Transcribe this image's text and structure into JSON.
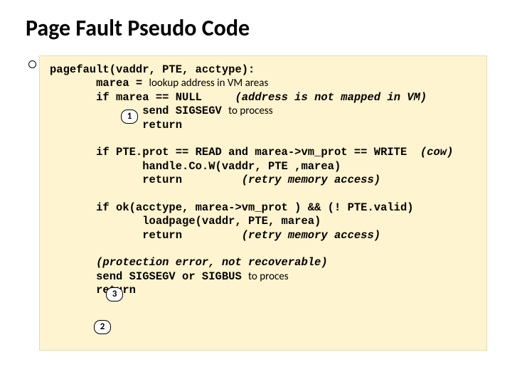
{
  "title": "Page Fault Pseudo Code",
  "code": {
    "l1": "pagefault(vaddr, PTE, acctype):",
    "l2a": "       marea = ",
    "l2b": "lookup address in VM areas",
    "l3a": "       if marea == NULL     ",
    "l3b": "(address is not mapped in VM)",
    "l4a": "              send SIGSEGV ",
    "l4b": "to process",
    "l5": "              return",
    "l6a": "       if PTE.prot == READ and marea->vm_prot == WRITE  ",
    "l6b": "(cow)",
    "l7": "              handle.Co.W(vaddr, PTE ,marea)",
    "l8a": "              return         ",
    "l8b": "(retry memory access)",
    "l9": "       if ok(acctype, marea->vm_prot ) && (! PTE.valid)",
    "l10": "              loadpage(vaddr, PTE, marea)",
    "l11a": "              return         ",
    "l11b": "(retry memory access)",
    "l12": "       (protection error, not recoverable)",
    "l13a": "       send SIGSEGV or SIGBUS ",
    "l13b": "to proces",
    "l14": "       return"
  },
  "badges": {
    "one": "1",
    "two": "2",
    "three": "3"
  }
}
